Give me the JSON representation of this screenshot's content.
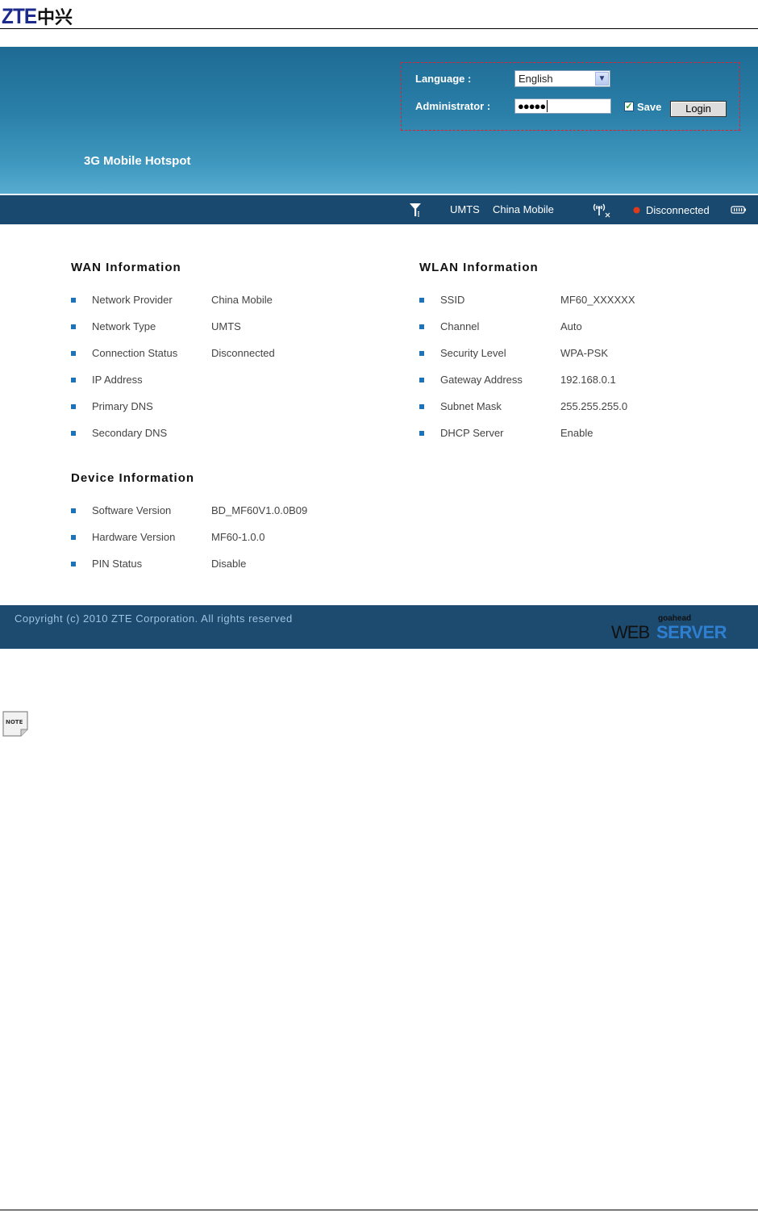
{
  "doc_header": {
    "logo_latin": "ZTE",
    "logo_cn": "中兴"
  },
  "banner": {
    "product_title": "3G Mobile Hotspot",
    "language_label": "Language :",
    "language_value": "English",
    "admin_label": "Administrator :",
    "password_mask": "●●●●●",
    "save_label": "Save",
    "save_checked": true,
    "login_label": "Login",
    "highlight_color": "#e0202a"
  },
  "status_bar": {
    "network_type": "UMTS",
    "provider": "China Mobile",
    "connection": "Disconnected",
    "connection_color": "#e03a1a"
  },
  "wan": {
    "title": "WAN Information",
    "rows": [
      {
        "label": "Network Provider",
        "value": "China Mobile"
      },
      {
        "label": "Network Type",
        "value": "UMTS"
      },
      {
        "label": "Connection Status",
        "value": "Disconnected"
      },
      {
        "label": "IP Address",
        "value": ""
      },
      {
        "label": "Primary DNS",
        "value": ""
      },
      {
        "label": "Secondary DNS",
        "value": ""
      }
    ]
  },
  "wlan": {
    "title": "WLAN Information",
    "rows": [
      {
        "label": "SSID",
        "value": "MF60_XXXXXX"
      },
      {
        "label": "Channel",
        "value": "Auto"
      },
      {
        "label": "Security Level",
        "value": "WPA-PSK"
      },
      {
        "label": "Gateway Address",
        "value": "192.168.0.1"
      },
      {
        "label": "Subnet Mask",
        "value": "255.255.255.0"
      },
      {
        "label": "DHCP Server",
        "value": "Enable"
      }
    ]
  },
  "device": {
    "title": "Device Information",
    "rows": [
      {
        "label": "Software Version",
        "value": "BD_MF60V1.0.0B09"
      },
      {
        "label": "Hardware Version",
        "value": "MF60-1.0.0"
      },
      {
        "label": "PIN Status",
        "value": "Disable"
      }
    ]
  },
  "footer": {
    "copyright": "Copyright (c) 2010 ZTE Corporation. All rights reserved",
    "ws_goahead": "goahead",
    "ws_web": "WEB",
    "ws_server": "SERVER"
  },
  "note": {
    "label": "NOTE"
  }
}
